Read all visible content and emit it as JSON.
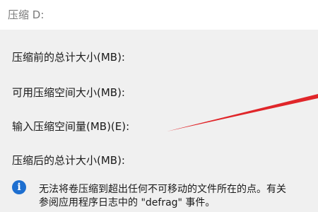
{
  "window": {
    "title": "压缩 D:"
  },
  "fields": {
    "total_before_label": "压缩前的总计大小(MB):",
    "available_label": "可用压缩空间大小(MB):",
    "input_label": "输入压缩空间量(MB)(E):",
    "total_after_label": "压缩后的总计大小(MB):"
  },
  "info": {
    "icon": "info-icon",
    "line1": "无法将卷压缩到超出任何不可移动的文件所在的点。有关",
    "line2": "参阅应用程序日志中的 \"defrag\" 事件。"
  },
  "annotation": {
    "arrow_color": "#e0262a"
  }
}
